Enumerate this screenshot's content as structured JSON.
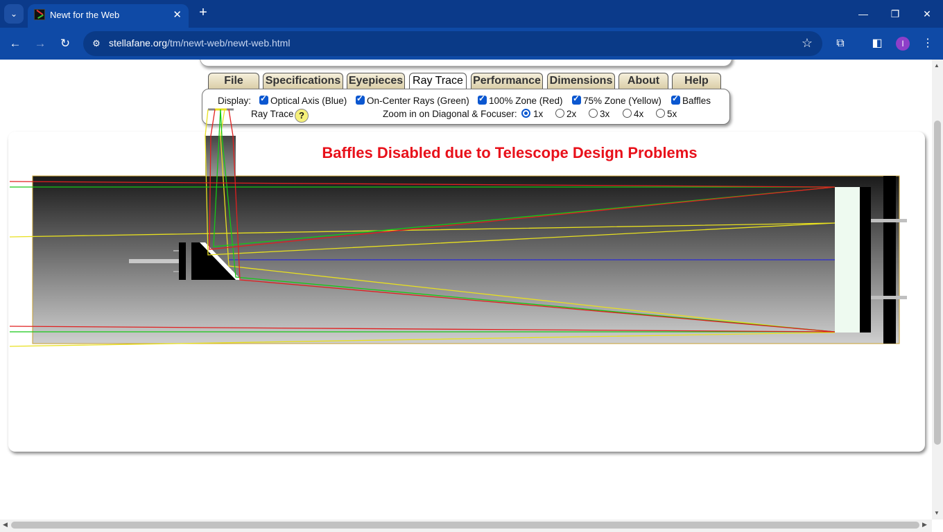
{
  "browser": {
    "tab_title": "Newt for the Web",
    "url_host": "stellafane.org",
    "url_path": "/tm/newt-web/newt-web.html",
    "profile_initial": "I"
  },
  "tabs": [
    {
      "label": "File"
    },
    {
      "label": "Specifications"
    },
    {
      "label": "Eyepieces"
    },
    {
      "label": "Ray Trace",
      "active": true
    },
    {
      "label": "Performance"
    },
    {
      "label": "Dimensions"
    },
    {
      "label": "About"
    },
    {
      "label": "Help"
    }
  ],
  "display": {
    "label": "Display:",
    "ray_trace_label": "Ray Trace",
    "help_glyph": "?",
    "checkboxes": [
      {
        "label": "Optical Axis (Blue)",
        "checked": true
      },
      {
        "label": "On-Center Rays (Green)",
        "checked": true
      },
      {
        "label": "100% Zone (Red)",
        "checked": true
      },
      {
        "label": "75% Zone (Yellow)",
        "checked": true
      },
      {
        "label": "Baffles",
        "checked": true
      }
    ],
    "zoom_label": "Zoom in on Diagonal & Focuser:",
    "zoom_options": [
      {
        "label": "1x",
        "selected": true
      },
      {
        "label": "2x",
        "selected": false
      },
      {
        "label": "3x",
        "selected": false
      },
      {
        "label": "4x",
        "selected": false
      },
      {
        "label": "5x",
        "selected": false
      }
    ]
  },
  "diagram": {
    "warning": "Baffles Disabled due to Telescope Design Problems",
    "colors": {
      "optical_axis": "#2a2ad0",
      "on_center": "#16c816",
      "zone_100": "#e02020",
      "zone_75": "#e8e020",
      "warning": "#e8101a"
    }
  }
}
